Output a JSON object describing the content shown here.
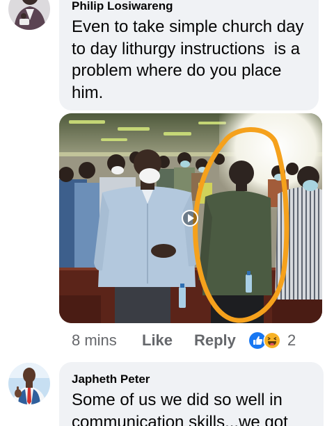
{
  "comments": [
    {
      "author": "Philip Losiwareng",
      "text": "Even to take simple church day to day lithurgy instructions  is a problem where do you place him.",
      "attachment": {
        "play_icon": "play-icon"
      },
      "time": "8 mins",
      "like_label": "Like",
      "reply_label": "Reply",
      "reactions": {
        "icons": [
          "like-icon",
          "haha-icon"
        ],
        "count": "2"
      }
    },
    {
      "author": "Japheth Peter",
      "text": "Some of us we did so well in communication skills...we got"
    }
  ],
  "colors": {
    "bubble": "#f0f2f5",
    "text": "#050505",
    "meta": "#65676b",
    "like_blue": "#1877f2",
    "haha_yellow": "#f7b125",
    "annotation_orange": "#f5a11c"
  }
}
